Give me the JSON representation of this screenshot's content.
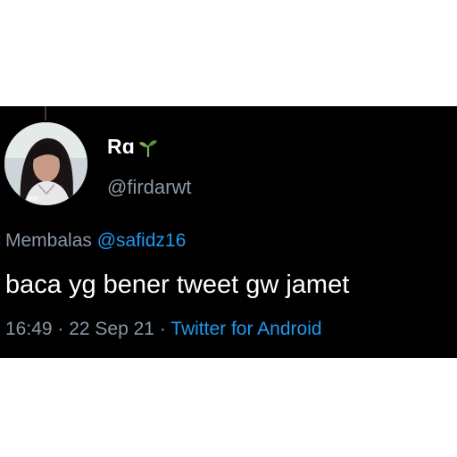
{
  "tweet": {
    "display_name": "Rɑ",
    "name_emoji": "seedling-icon",
    "handle": "@firdarwt",
    "reply_prefix": "Membalas",
    "reply_to": "@safidz16",
    "text": "baca yg bener tweet gw jamet",
    "time": "16:49",
    "separator": " · ",
    "date": "22 Sep 21",
    "source": "Twitter for Android"
  },
  "colors": {
    "background": "#000000",
    "muted": "#8b98a5",
    "link": "#1d9bf0",
    "text": "#ffffff"
  }
}
